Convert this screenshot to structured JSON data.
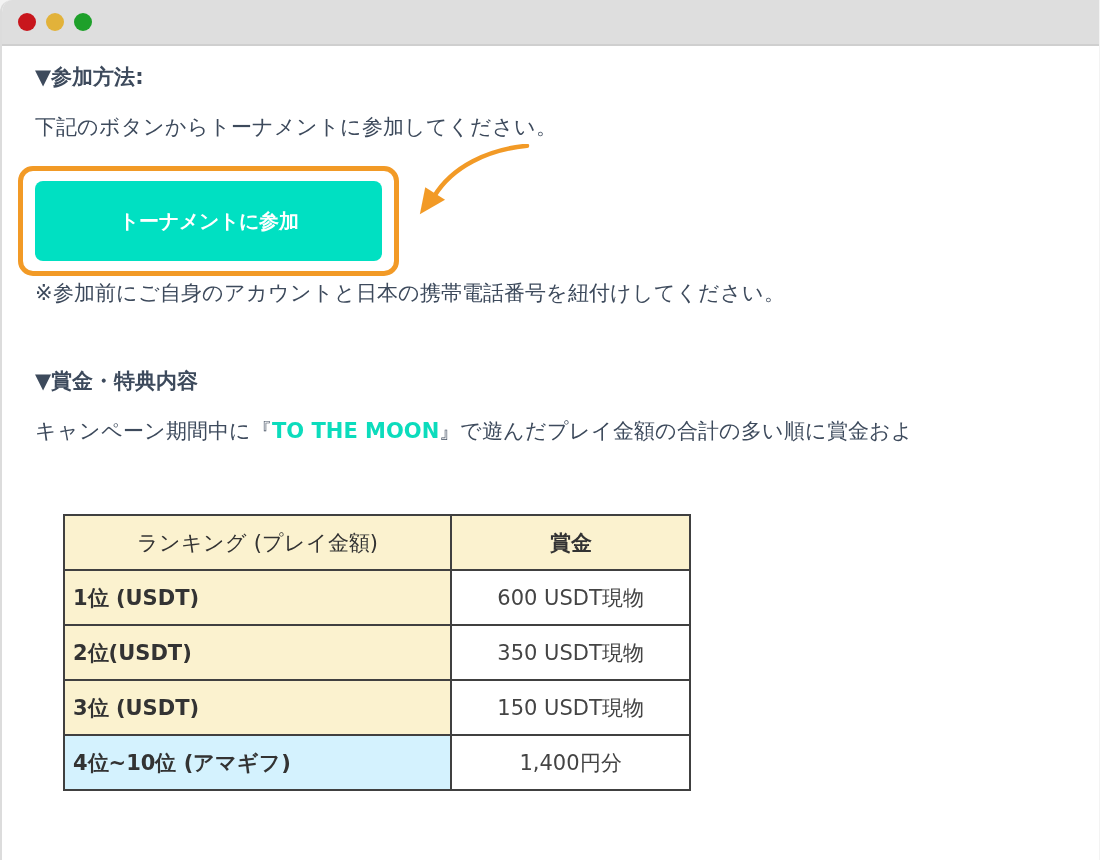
{
  "window": {
    "controls": [
      {
        "kind": "close",
        "color": "#c8161d"
      },
      {
        "kind": "minimize",
        "color": "#e2b23a"
      },
      {
        "kind": "zoom",
        "color": "#1ea02a"
      }
    ]
  },
  "join_section": {
    "heading": "▼参加方法:",
    "text": "下記のボタンからトーナメントに参加してください。",
    "button": {
      "label": "トーナメントに参加",
      "highlighted": true
    },
    "note": "※参加前にご自身のアカウントと日本の携帯電話番号を紐付けしてください。"
  },
  "prize_section": {
    "heading": "▼賞金・特典内容",
    "text": "キャンペーン期間中に『**TO THE MOON**』で遊んだプレイ金額の合計の多い順に賞金およ"
  },
  "table": {
    "columns": [
      "ランキング (プレイ金額)",
      "賞金"
    ],
    "rows": [
      {
        "rank": "1位 (USDT)",
        "prize": "600 USDT現物",
        "color": "#fbf2cf"
      },
      {
        "rank": "2位(USDT)",
        "prize": "350 USDT現物",
        "color": "#fbf2cf"
      },
      {
        "rank": "3位 (USDT)",
        "prize": "150 USDT現物",
        "color": "#fbf2cf"
      },
      {
        "rank": "4位~10位 (アマギフ)",
        "prize": "1,400円分",
        "color": "#d4f2fe"
      }
    ]
  }
}
